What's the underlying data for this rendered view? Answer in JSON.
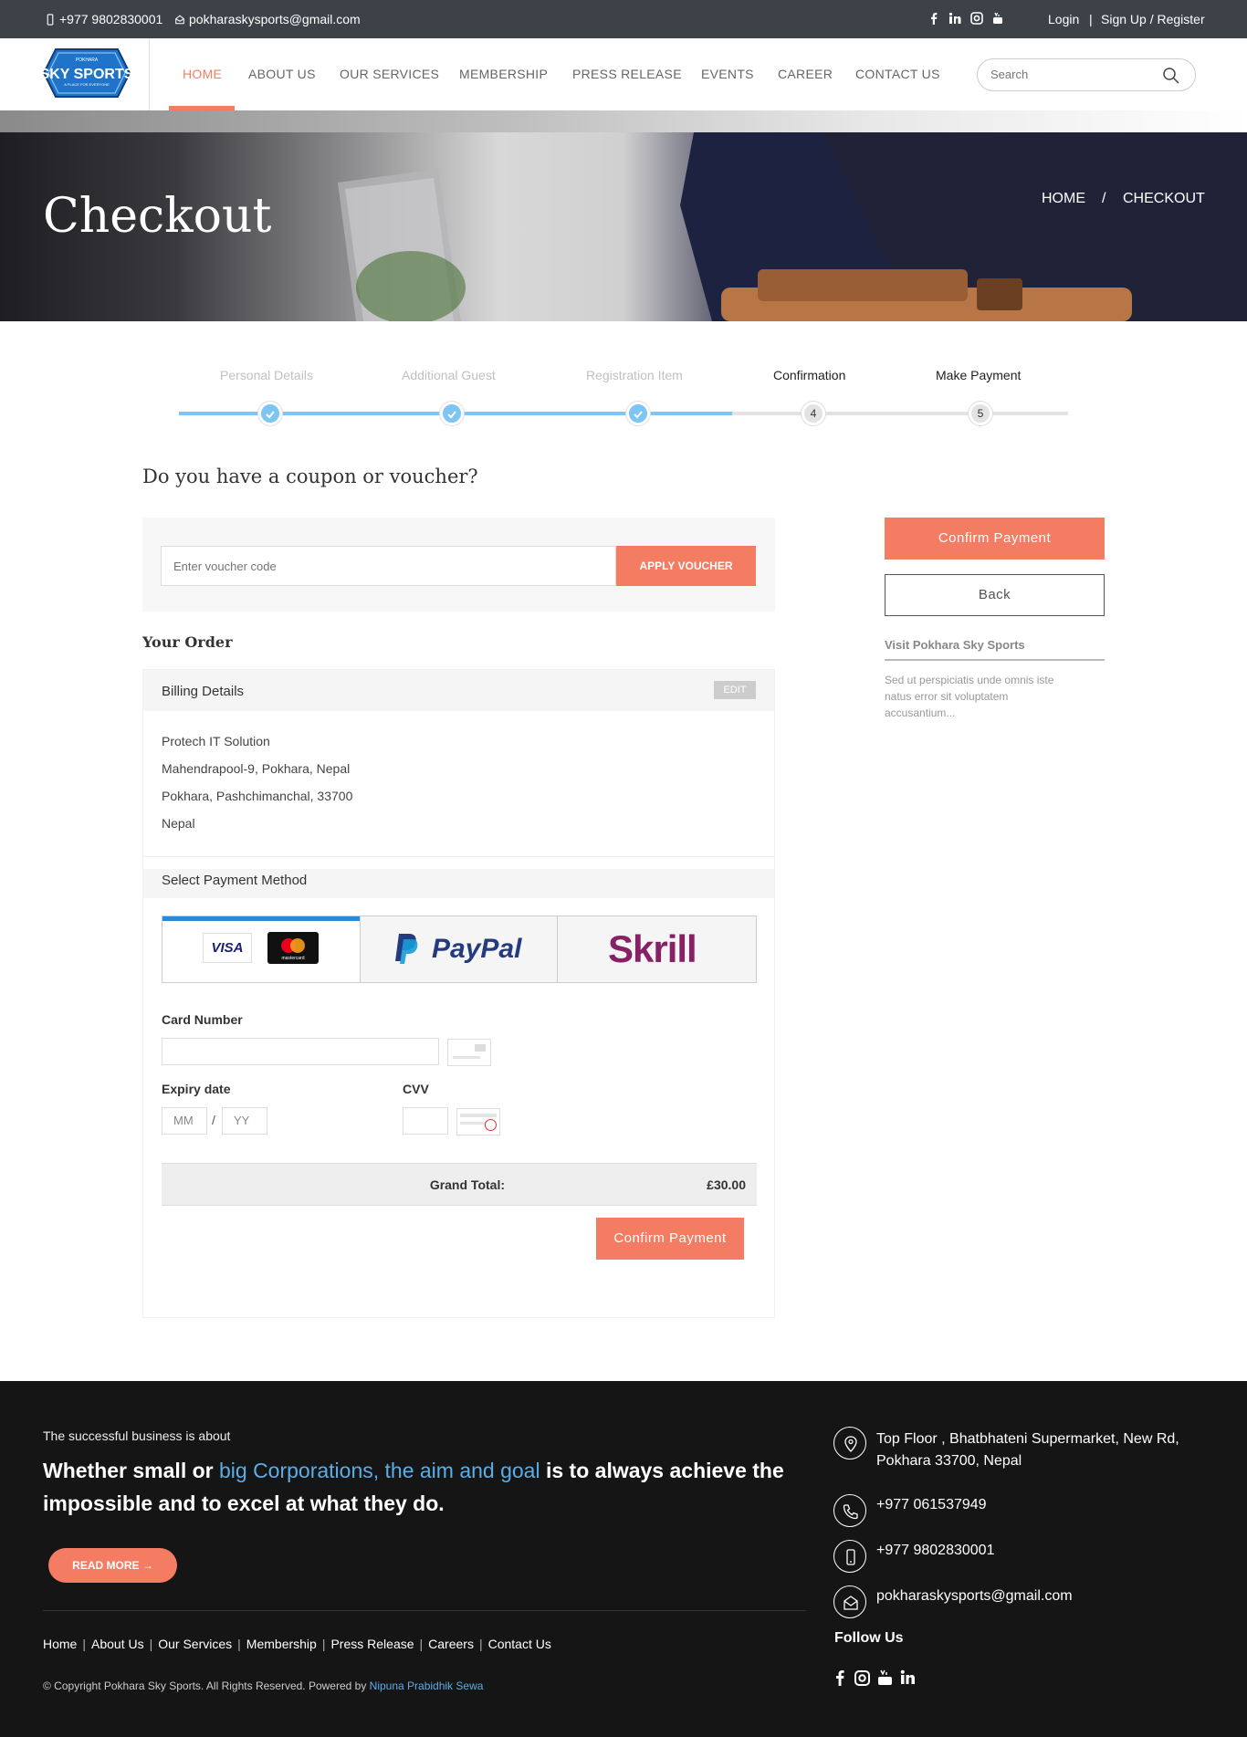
{
  "topbar": {
    "phone": "+977 9802830001",
    "email": "pokharaskysports@gmail.com",
    "social": [
      "facebook-icon",
      "linkedin-icon",
      "instagram-icon",
      "youtube-icon"
    ],
    "login": "Login",
    "sep": "|",
    "signup": "Sign Up / Register"
  },
  "logo": {
    "top": "POKHARA",
    "main": "SKY SPORTS",
    "tag": "A PLACE FOR EVERYONE"
  },
  "nav": {
    "items": [
      "HOME",
      "ABOUT US",
      "OUR SERVICES",
      "MEMBERSHIP",
      "PRESS RELEASE",
      "EVENTS",
      "CAREER",
      "CONTACT US"
    ],
    "active": "HOME"
  },
  "search": {
    "placeholder": "Search"
  },
  "hero": {
    "title": "Checkout",
    "breadcrumb": [
      "HOME",
      "/",
      "CHECKOUT"
    ]
  },
  "steps": [
    {
      "label": "Personal Details",
      "state": "done"
    },
    {
      "label": "Additional Guest",
      "state": "done"
    },
    {
      "label": "Registration Item",
      "state": "done"
    },
    {
      "label": "Confirmation",
      "state": "current",
      "number": "4"
    },
    {
      "label": "Make Payment",
      "state": "current",
      "number": "5"
    }
  ],
  "coupon": {
    "heading": "Do you have a coupon or voucher?",
    "placeholder": "Enter voucher code",
    "button": "APPLY VOUCHER"
  },
  "order": {
    "heading": "Your Order",
    "billing_title": "Billing Details",
    "edit": "EDIT",
    "address": [
      "Protech IT Solution",
      "Mahendrapool-9, Pokhara, Nepal",
      "Pokhara, Pashchimanchal, 33700",
      "Nepal"
    ],
    "payment_title": "Select Payment Method",
    "methods": [
      "VISA",
      "mastercard",
      "PayPal",
      "Skrill"
    ],
    "card_number_label": "Card Number",
    "expiry_label": "Expiry date",
    "cvv_label": "CVV",
    "mm": "MM",
    "slash": "/",
    "yy": "YY",
    "grand_total_label": "Grand Total:",
    "grand_total_value": "£30.00",
    "confirm": "Confirm Payment"
  },
  "sidebar": {
    "confirm": "Confirm Payment",
    "back": "Back",
    "visit_title": "Visit Pokhara Sky Sports",
    "visit_text": "Sed ut perspiciatis unde omnis iste natus error sit voluptatem accusantium..."
  },
  "footer": {
    "small": "The successful business is about",
    "big_1": "Whether small or ",
    "big_hl": "big Corporations, the aim and goal",
    "big_2": " is to always achieve the impossible and to excel at what they do.",
    "read_more": "READ MORE →",
    "links": [
      "Home",
      "About Us",
      "Our Services",
      "Membership",
      "Press Release",
      "Careers",
      "Contact Us"
    ],
    "link_sep": "|",
    "copyright": "© Copyright Pokhara Sky Sports. All Rights Reserved. Powered by ",
    "powered": "Nipuna Prabidhik Sewa",
    "address": "Top Floor , Bhatbhateni Supermarket, New Rd, Pokhara 33700, Nepal",
    "tel": "+977 061537949",
    "mobile": "+977 9802830001",
    "email": "pokharaskysports@gmail.com",
    "follow": "Follow Us",
    "social": [
      "facebook-icon",
      "instagram-icon",
      "youtube-icon",
      "linkedin-icon"
    ]
  },
  "colors": {
    "accent": "#f47c62",
    "step_done": "#7dc6f3",
    "link_blue": "#5aaee8",
    "topbar": "#3d4148",
    "footer": "#151515"
  }
}
